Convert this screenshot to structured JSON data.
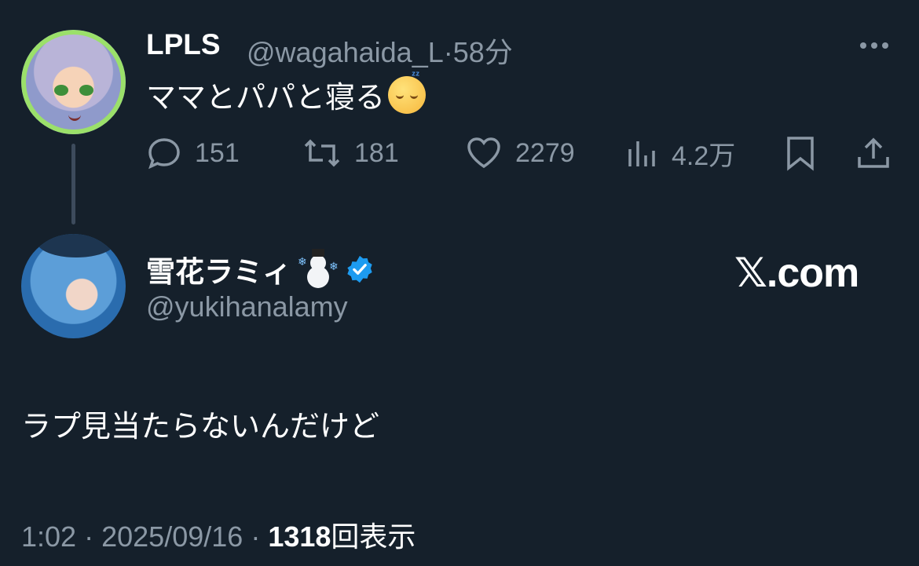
{
  "parent_tweet": {
    "display_name": "LPLS",
    "handle": "@wagahaida_L",
    "time_sep": "·",
    "time": "58分",
    "text": "ママとパパと寝る",
    "emoji": "sleeping-face",
    "actions": {
      "replies": "151",
      "retweets": "181",
      "likes": "2279",
      "views": "4.2万"
    }
  },
  "main_tweet": {
    "display_name": "雪花ラミィ",
    "name_emoji": "snowman-with-snow",
    "verified": true,
    "handle": "@yukihanalamy",
    "brand": "𝕏.com",
    "text": "ラプ見当たらないんだけど",
    "meta": {
      "time": "1:02",
      "sep1": "·",
      "date": "2025/09/16",
      "sep2": "·",
      "views_count": "1318",
      "views_label": "回表示"
    }
  },
  "colors": {
    "background": "#15202b",
    "secondary_text": "#8b98a5",
    "verified_blue": "#1d9bf0",
    "thread_line": "#3d4b5c"
  }
}
